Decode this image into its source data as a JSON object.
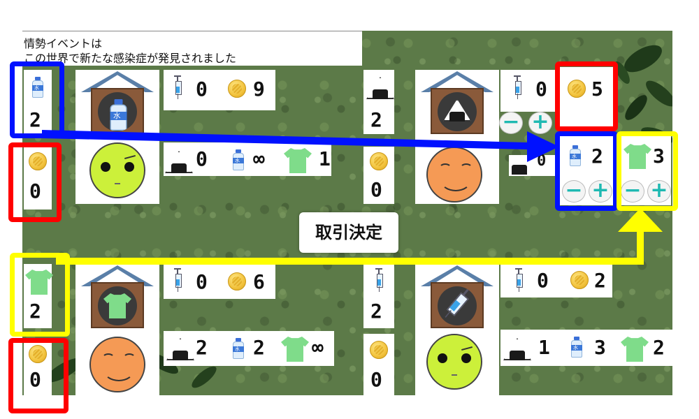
{
  "event": {
    "title": "情勢イベントは",
    "message": "この世界で新たな感染症が発見されました"
  },
  "trade_button": {
    "label": "取引決定"
  },
  "minus_label": "−",
  "plus_label": "+",
  "top_left": {
    "side_item": "2",
    "side_coin": "0",
    "syringe": "0",
    "coin": "9",
    "onigiri": "0",
    "water": "∞",
    "shirt": "1"
  },
  "top_right": {
    "side_item": "2",
    "side_coin": "0",
    "syringe": "0",
    "coin": "5",
    "onigiri": "0",
    "water": "2",
    "shirt": "3"
  },
  "bottom_left": {
    "side_item": "2",
    "side_coin": "0",
    "syringe": "0",
    "coin": "6",
    "onigiri": "2",
    "water": "2",
    "shirt": "∞"
  },
  "bottom_right": {
    "side_item": "2",
    "side_coin": "0",
    "syringe": "0",
    "coin": "2",
    "onigiri": "1",
    "water": "3",
    "shirt": "2"
  },
  "colors": {
    "red": "#ff0000",
    "blue": "#0011ff",
    "yellow": "#ffff00",
    "grass": "#5c7a48"
  }
}
